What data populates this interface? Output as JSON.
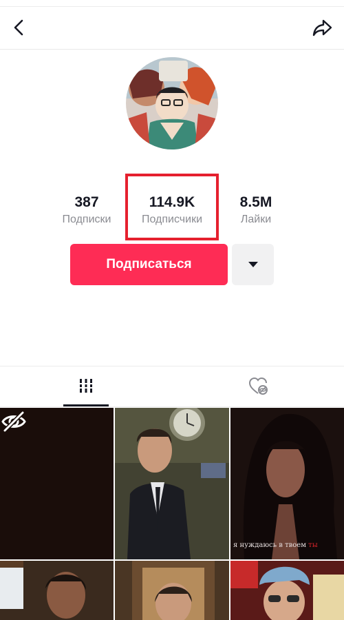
{
  "stats": {
    "following": {
      "value": "387",
      "label": "Подписки"
    },
    "followers": {
      "value": "114.9K",
      "label": "Подписчики"
    },
    "likes": {
      "value": "8.5M",
      "label": "Лайки"
    }
  },
  "actions": {
    "follow_label": "Подписаться"
  },
  "highlight_color": "#e5202e",
  "accent_color": "#fe2c55",
  "icons": {
    "back": "back-arrow-icon",
    "share": "share-arrow-icon",
    "videos_tab": "grid-bars-icon",
    "liked_tab": "heart-hidden-icon",
    "private": "eye-off-icon",
    "more": "caret-down-icon"
  },
  "videos": [
    {
      "caption": ""
    },
    {
      "caption": ""
    },
    {
      "caption_text": "я нуждаюсь в твоем",
      "caption_red": "ты"
    },
    {
      "caption": ""
    },
    {
      "caption": ""
    },
    {
      "caption": ""
    }
  ]
}
